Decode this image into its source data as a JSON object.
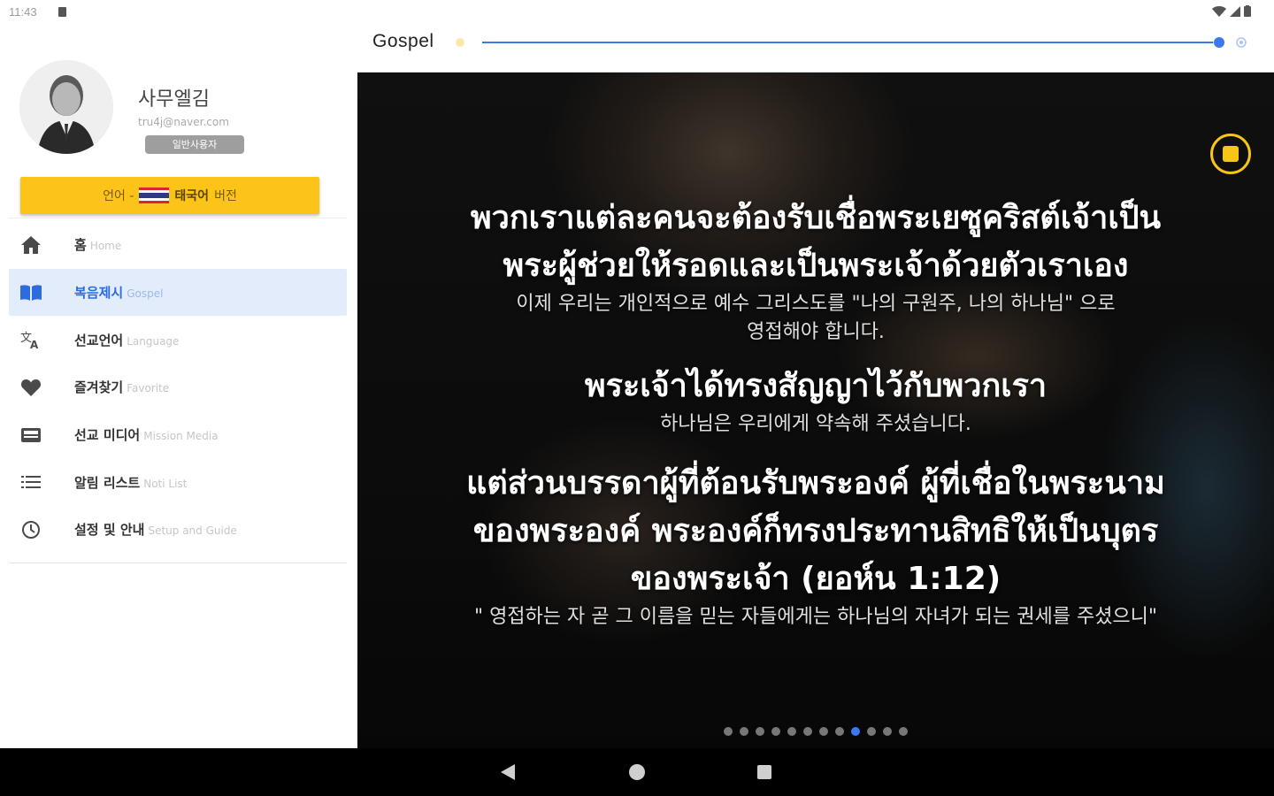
{
  "status_bar": {
    "time": "11:43"
  },
  "profile": {
    "name": "사무엘김",
    "email": "tru4j@naver.com",
    "badge": "일반사용자"
  },
  "language_button": {
    "prefix": "언어 -",
    "language": "태국어",
    "suffix": "버전",
    "flag": "thailand-flag"
  },
  "nav": {
    "items": [
      {
        "label": "홈",
        "sub": "Home",
        "icon": "home-icon"
      },
      {
        "label": "복음제시",
        "sub": "Gospel",
        "icon": "book-icon",
        "active": true
      },
      {
        "label": "선교언어",
        "sub": "Language",
        "icon": "translate-icon"
      },
      {
        "label": "즐겨찾기",
        "sub": "Favorite",
        "icon": "heart-icon"
      },
      {
        "label": "선교 미디어",
        "sub": "Mission Media",
        "icon": "media-icon"
      },
      {
        "label": "알림 리스트",
        "sub": "Noti List",
        "icon": "list-icon"
      },
      {
        "label": "설정 및 안내",
        "sub": "Setup and Guide",
        "icon": "settings-icon"
      }
    ]
  },
  "topbar": {
    "title": "Gospel",
    "progress_fraction": 0.99
  },
  "slide": {
    "thai1": [
      "พวกเราแต่ละคนจะต้องรับเชื่อพระเยซูคริสต์เจ้าเป็น",
      "พระผู้ช่วยให้รอดและเป็นพระเจ้าด้วยตัวเราเอง"
    ],
    "kor1": [
      "이제 우리는 개인적으로 예수 그리스도를 \"나의 구원주, 나의 하나님\" 으로",
      "영접해야 합니다."
    ],
    "thai2": "พระเจ้าได้ทรงสัญญาไว้กับพวกเรา",
    "kor2": "하나님은 우리에게 약속해 주셨습니다.",
    "thai3": [
      "แต่ส่วนบรรดาผู้ที่ต้อนรับพระองค์ ผู้ที่เชื่อในพระนาม",
      "ของพระองค์ พระองค์ก็ทรงประทานสิทธิให้เป็นบุตร",
      "ของพระเจ้า (ยอห์น 1:12)"
    ],
    "kor3": "\" 영접하는 자 곧 그 이름을 믿는 자들에게는 하나님의 자녀가 되는 권세를 주셨으니\""
  },
  "pagination": {
    "total": 12,
    "current": 9
  },
  "colors": {
    "accent": "#3a78ee",
    "yellow": "#fcc419",
    "active_bg": "#e3ecfb"
  }
}
